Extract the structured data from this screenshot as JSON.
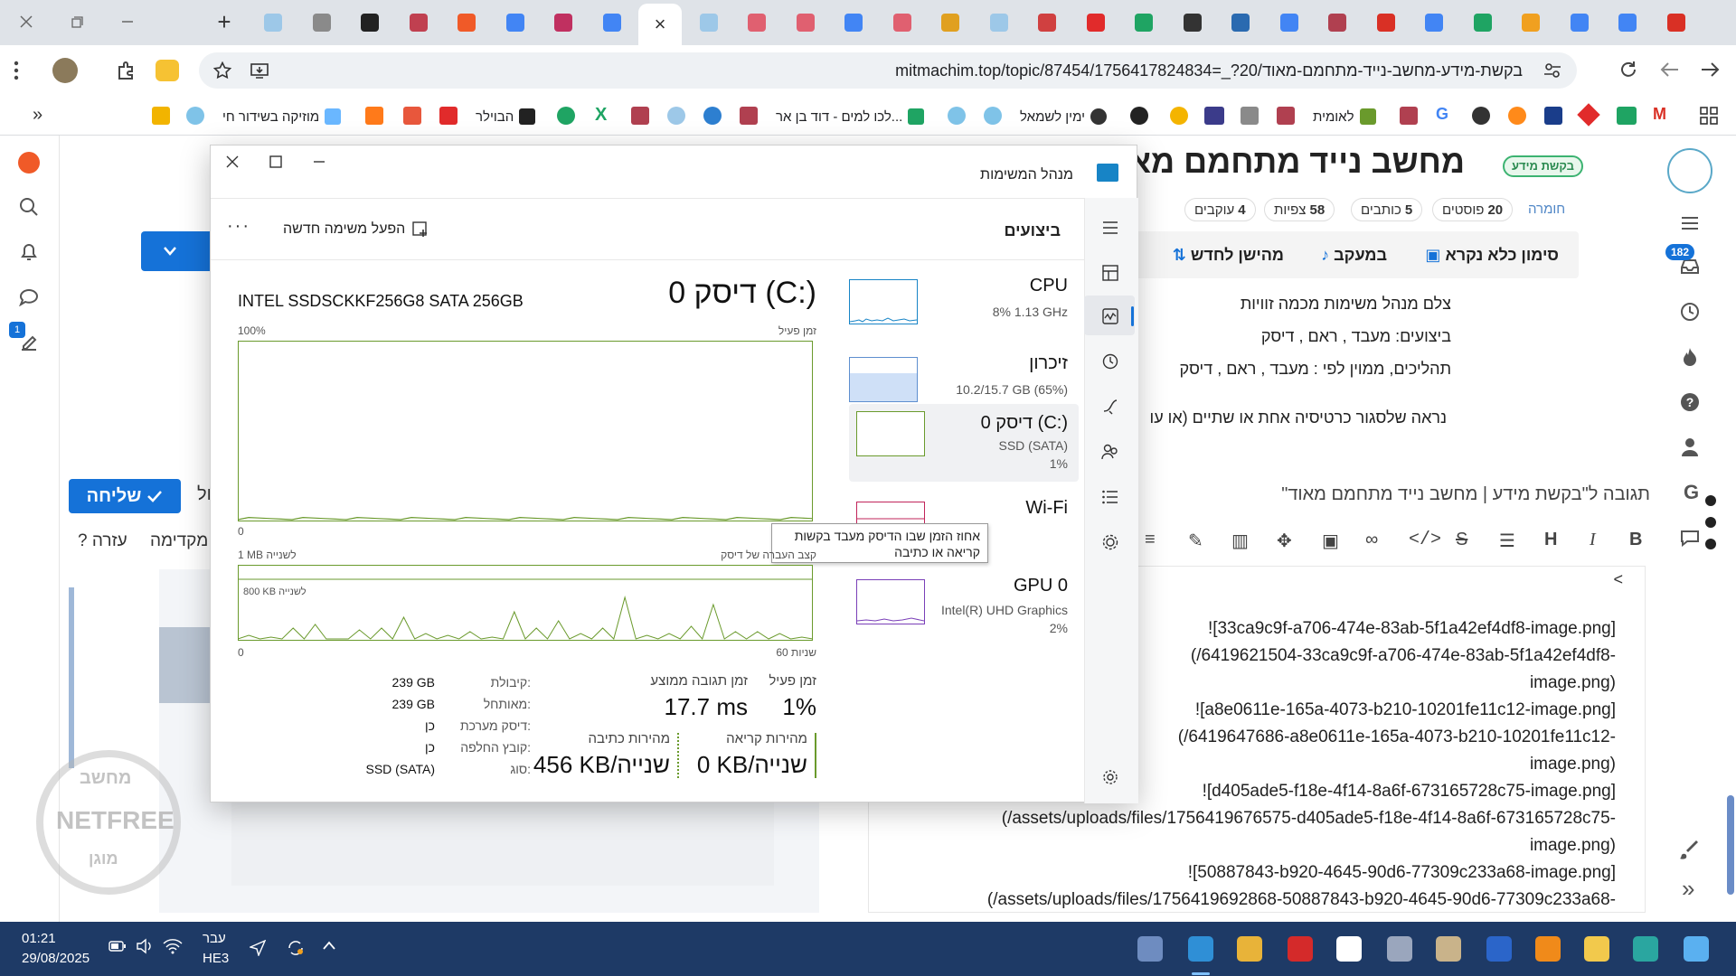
{
  "browser": {
    "url": "mitmachim.top/topic/87454/1756417824834=_?20/בקשת-מידע-מחשב-נייד-מתחמם-מאוד",
    "tab_close_glyph": "×",
    "new_tab_glyph": "+",
    "bookmarks": [
      {
        "label": "מוזיקה בשידור חי",
        "icon": "music-icon",
        "color": "#6ab7ff"
      },
      {
        "label": "הבוילר",
        "icon": "boiler-icon",
        "color": "#222222"
      },
      {
        "label": "לכו למים - דוד בן אר...",
        "icon": "drive-icon",
        "color": "#1fa463"
      },
      {
        "label": "ימין לשמאל",
        "icon": "rtl-icon",
        "color": "#4aa3df"
      },
      {
        "label": "לאומית",
        "icon": "shield-icon",
        "color": "#b04050"
      }
    ]
  },
  "topic": {
    "title": "מחשב נייד מתחמם מאוד",
    "category_badge": "בקשת מידע",
    "hardware_label": "חומרה",
    "stats": [
      {
        "value": "20",
        "label": "פוסטים"
      },
      {
        "value": "5",
        "label": "כותבים"
      },
      {
        "value": "58",
        "label": "צפיות"
      },
      {
        "value": "4",
        "label": "עוקבים"
      }
    ],
    "actions": {
      "mark_read": "סימון כלא נקרא",
      "tracking": "במעקב",
      "sort": "מהישן לחדש"
    },
    "post_lines": [
      "צלם מנהל משימות מכמה זוויות",
      "ביצועים: מעבד , ראם , דיסק",
      "תהליכים, ממוין לפי : מעבד , ראם , דיסק",
      "נראה שלסגור כרטיסיה אחת או שתיים (או עו"
    ],
    "notif_count": "182"
  },
  "composer": {
    "title": "תגובה ל\"בקשת מידע | מחשב נייד מתחמם מאוד\"",
    "send_label": "שליחה",
    "help_label": "עזרה ?",
    "preview_label": "מקדימה",
    "cursor_char": "<",
    "editor_lines": [
      "![33ca9c9f-a706-474e-83ab-5f1a42ef4df8-image.png]",
      "(/6419621504-33ca9c9f-a706-474e-83ab-5f1a42ef4df8-",
      "image.png)",
      "![a8e0611e-165a-4073-b210-10201fe11c12-image.png]",
      "(/6419647686-a8e0611e-165a-4073-b210-10201fe11c12-",
      "image.png)",
      "![d405ade5-f18e-4f14-8a6f-673165728c75-image.png]",
      "(/assets/uploads/files/1756419676575-d405ade5-f18e-4f14-8a6f-673165728c75-",
      "image.png)",
      "![50887843-b920-4645-90d6-77309c233a68-image.png]",
      "(/assets/uploads/files/1756419692868-50887843-b920-4645-90d6-77309c233a68-"
    ]
  },
  "taskmanager": {
    "window_title": "מנהל המשימות",
    "section_title": "ביצועים",
    "run_new_task": "הפעל משימה חדשה",
    "more_glyph": "···",
    "disk_title": "דיסק 0 (C:)",
    "disk_model": "INTEL SSDSCKKF256G8 SATA 256GB",
    "chart1": {
      "title": "זמן פעיל",
      "max_label": "100%",
      "min_label": "0",
      "tooltip": "אחוז הזמן שבו הדיסק מעבד בקשות קריאה או כתיבה"
    },
    "chart2": {
      "title": "קצב העברה של דיסק",
      "max_label": "1 MB לשנייה",
      "mid_label": "800 KB לשנייה",
      "min_label": "0",
      "time_label": "60 שניות"
    },
    "stats": {
      "active_time_label": "זמן פעיל",
      "active_time_value": "1%",
      "avg_response_label": "זמן תגובה ממוצע",
      "avg_response_value": "17.7 ms",
      "read_speed_label": "מהירות קריאה",
      "read_speed_value": "0 KB/שנייה",
      "write_speed_label": "מהירות כתיבה",
      "write_speed_value": "456 KB/שנייה"
    },
    "properties": [
      {
        "label": "קיבולת:",
        "value": "239 GB"
      },
      {
        "label": "מאותחל:",
        "value": "239 GB"
      },
      {
        "label": "דיסק מערכת:",
        "value": "כן"
      },
      {
        "label": "קובץ החלפה:",
        "value": "כן"
      },
      {
        "label": "סוג:",
        "value": "SSD (SATA)"
      }
    ],
    "perf_list": [
      {
        "name": "CPU",
        "sub1": "8%  1.13 GHz",
        "sub2": "",
        "color": "#1784c6"
      },
      {
        "name": "זיכרון",
        "sub1": "10.2/15.7 GB (65%)",
        "sub2": "",
        "color": "#5e8fcf"
      },
      {
        "name": "דיסק 0 (C:)",
        "sub1": "SSD (SATA)",
        "sub2": "1%",
        "color": "#6a9a2c"
      },
      {
        "name": "Wi-Fi",
        "sub1": "Wi-Fi",
        "sub2": "",
        "color": "#c1245a"
      },
      {
        "name": "GPU 0",
        "sub1": "Intel(R) UHD Graphics",
        "sub2": "2%",
        "color": "#7a3fb8"
      }
    ]
  },
  "taskbar": {
    "time": "01:21",
    "date": "29/08/2025",
    "lang1": "עבר",
    "lang2": "HE3"
  },
  "watermark": {
    "line1": "מחשב",
    "line2": "NETFREE",
    "line3": "מוגן"
  },
  "colors": {
    "accent_blue": "#1572d8",
    "taskbar": "#1e3a66",
    "badge_green": "#3cb371",
    "disk_green": "#6a9a2c"
  }
}
